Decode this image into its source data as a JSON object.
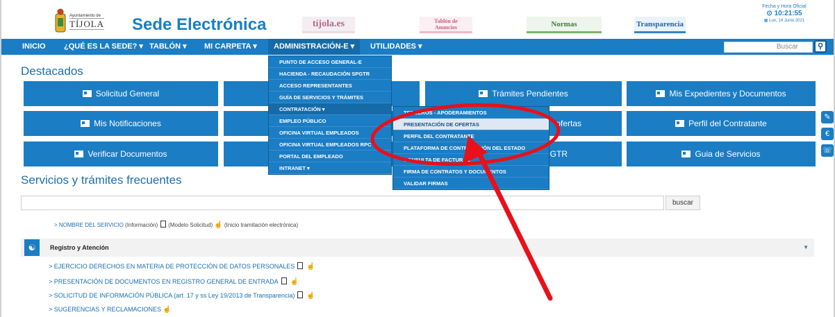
{
  "header": {
    "logo_small": "Ayuntamiento de",
    "logo_name": "TÍJOLA",
    "site_title": "Sede Electrónica",
    "links": [
      "tíjola.es",
      "Tablón de\nAnuncios",
      "Normas",
      "Transparencia"
    ],
    "clock_label": "Fecha y Hora Oficial",
    "clock_time": "⊙ 10:21:55",
    "clock_date": "▦ Lun, 14 Junio 2021"
  },
  "nav": {
    "items": [
      "INICIO",
      "¿QUÉ ES LA SEDE? ▾",
      "TABLÓN ▾",
      "MI CARPETA ▾",
      "ADMINISTRACIÓN-E ▾",
      "UTILIDADES ▾"
    ],
    "search_placeholder": "Buscar"
  },
  "destacados": {
    "title": "Destacados",
    "tiles": [
      "Solicitud General",
      "Trámites Pendientes",
      "Mis Expedientes y Documentos",
      "Mis Notificaciones",
      "ofertas",
      "Perfil del Contratante",
      "Verificar Documentos",
      "GTR",
      "Guia de Servicios"
    ]
  },
  "admin_menu": [
    "PUNTO DE ACCESO GENERAL-E",
    "HACIENDA - RECAUDACIÓN SPGTR",
    "ACCESO REPRESENTANTES",
    "GUÍA DE SERVICIOS Y TRÁMITES",
    "CONTRATACIÓN ▾",
    "EMPLEO PÚBLICO",
    "OFICINA VIRTUAL EMPLEADOS",
    "OFICINA VIRTUAL EMPLEADOS RPC",
    "PORTAL DEL EMPLEADO",
    "INTRANET ▾"
  ],
  "contratacion_menu": [
    "TERCEROS - APODERAMIENTOS",
    "PRESENTACIÓN DE OFERTAS",
    "PERFIL DEL CONTRATANTE",
    "PLATAFORMA DE CONTRATACIÓN DEL ESTADO",
    "CONSULTA DE FACTURAS",
    "FIRMA DE CONTRATOS Y DOCUMENTOS",
    "VALIDAR FIRMAS"
  ],
  "servicios": {
    "title": "Servicios y trámites frecuentes",
    "search_button": "buscar",
    "legend_link": "> NOMBRE DEL SERVICIO",
    "legend_info": "(Información)",
    "legend_modelo": "(Modelo Solicitud)",
    "legend_inicio": "(Inicio tramitación electrónica)",
    "category": "Registro y Atención",
    "rows": [
      "> EJERCICIO DERECHOS EN MATERIA DE PROTECCIÓN DE DATOS PERSONALES",
      "> PRESENTACIÓN DE DOCUMENTOS EN REGISTRO GENERAL DE ENTRADA",
      "> SOLICITUD DE INFORMACIÓN PÚBLICA (art. 17 y ss Ley 19/2013 de Transparencia)",
      "> SUGERENCIAS Y RECLAMACIONES"
    ]
  },
  "colors": {
    "primary": "#1b7dc4",
    "annotation": "#e8101a"
  },
  "icons": [
    "search-icon",
    "card-icon",
    "document-icon",
    "hand-pointer-icon",
    "handshake-icon",
    "side-tool-icon",
    "euro-icon",
    "support-icon"
  ]
}
